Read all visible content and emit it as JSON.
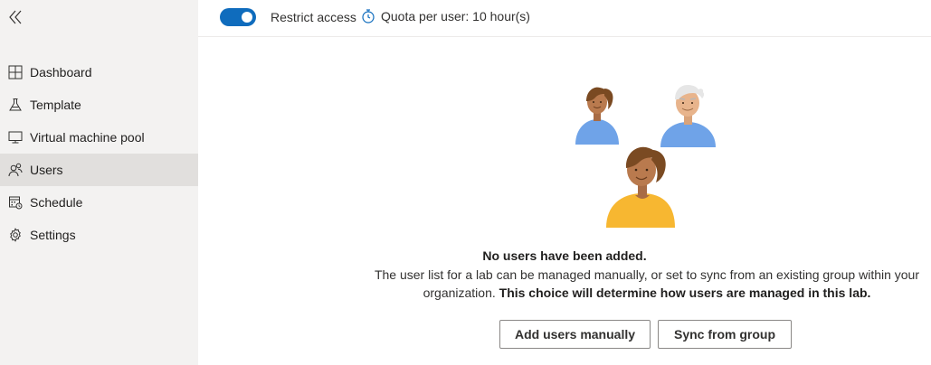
{
  "sidebar": {
    "collapse_icon": "double-chevron-left-icon",
    "items": [
      {
        "label": "Dashboard",
        "icon": "dashboard-icon",
        "selected": false
      },
      {
        "label": "Template",
        "icon": "flask-icon",
        "selected": false
      },
      {
        "label": "Virtual machine pool",
        "icon": "monitor-icon",
        "selected": false
      },
      {
        "label": "Users",
        "icon": "users-icon",
        "selected": true
      },
      {
        "label": "Schedule",
        "icon": "calendar-icon",
        "selected": false
      },
      {
        "label": "Settings",
        "icon": "gear-icon",
        "selected": false
      }
    ]
  },
  "toolbar": {
    "restrict_access": {
      "label": "Restrict access",
      "on": true
    },
    "quota": {
      "label": "Quota per user: 10 hour(s)",
      "icon": "stopwatch-icon"
    }
  },
  "empty_state": {
    "title": "No users have been added.",
    "description_line1": "The user list for a lab can be managed manually, or set to sync from an existing group within your",
    "description_line2_plain": "organization. ",
    "description_line2_bold": "This choice will determine how users are managed in this lab.",
    "add_button": "Add users manually",
    "sync_button": "Sync from group"
  },
  "colors": {
    "accent": "#0f6cbd",
    "sidebar_bg": "#f3f2f1",
    "selected_bg": "#e1dfdd"
  }
}
